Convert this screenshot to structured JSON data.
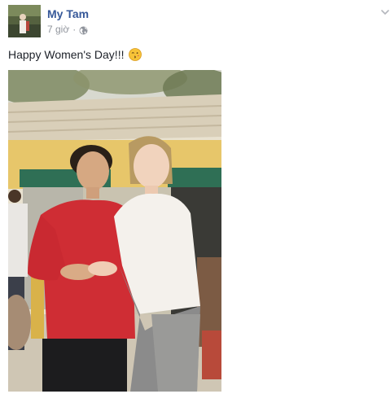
{
  "post": {
    "author_name": "My Tam",
    "timestamp": "7 giờ",
    "separator": "·",
    "privacy_icon": "globe-icon",
    "menu_icon": "chevron-down-icon",
    "caption": "Happy Women's Day!!!",
    "caption_emoji": "kissing-face-emoji",
    "photo_alt": "Two women standing together in front of a yellow house",
    "colors": {
      "author_link": "#365899",
      "meta_text": "#90949c",
      "body_text": "#1d2129"
    }
  }
}
